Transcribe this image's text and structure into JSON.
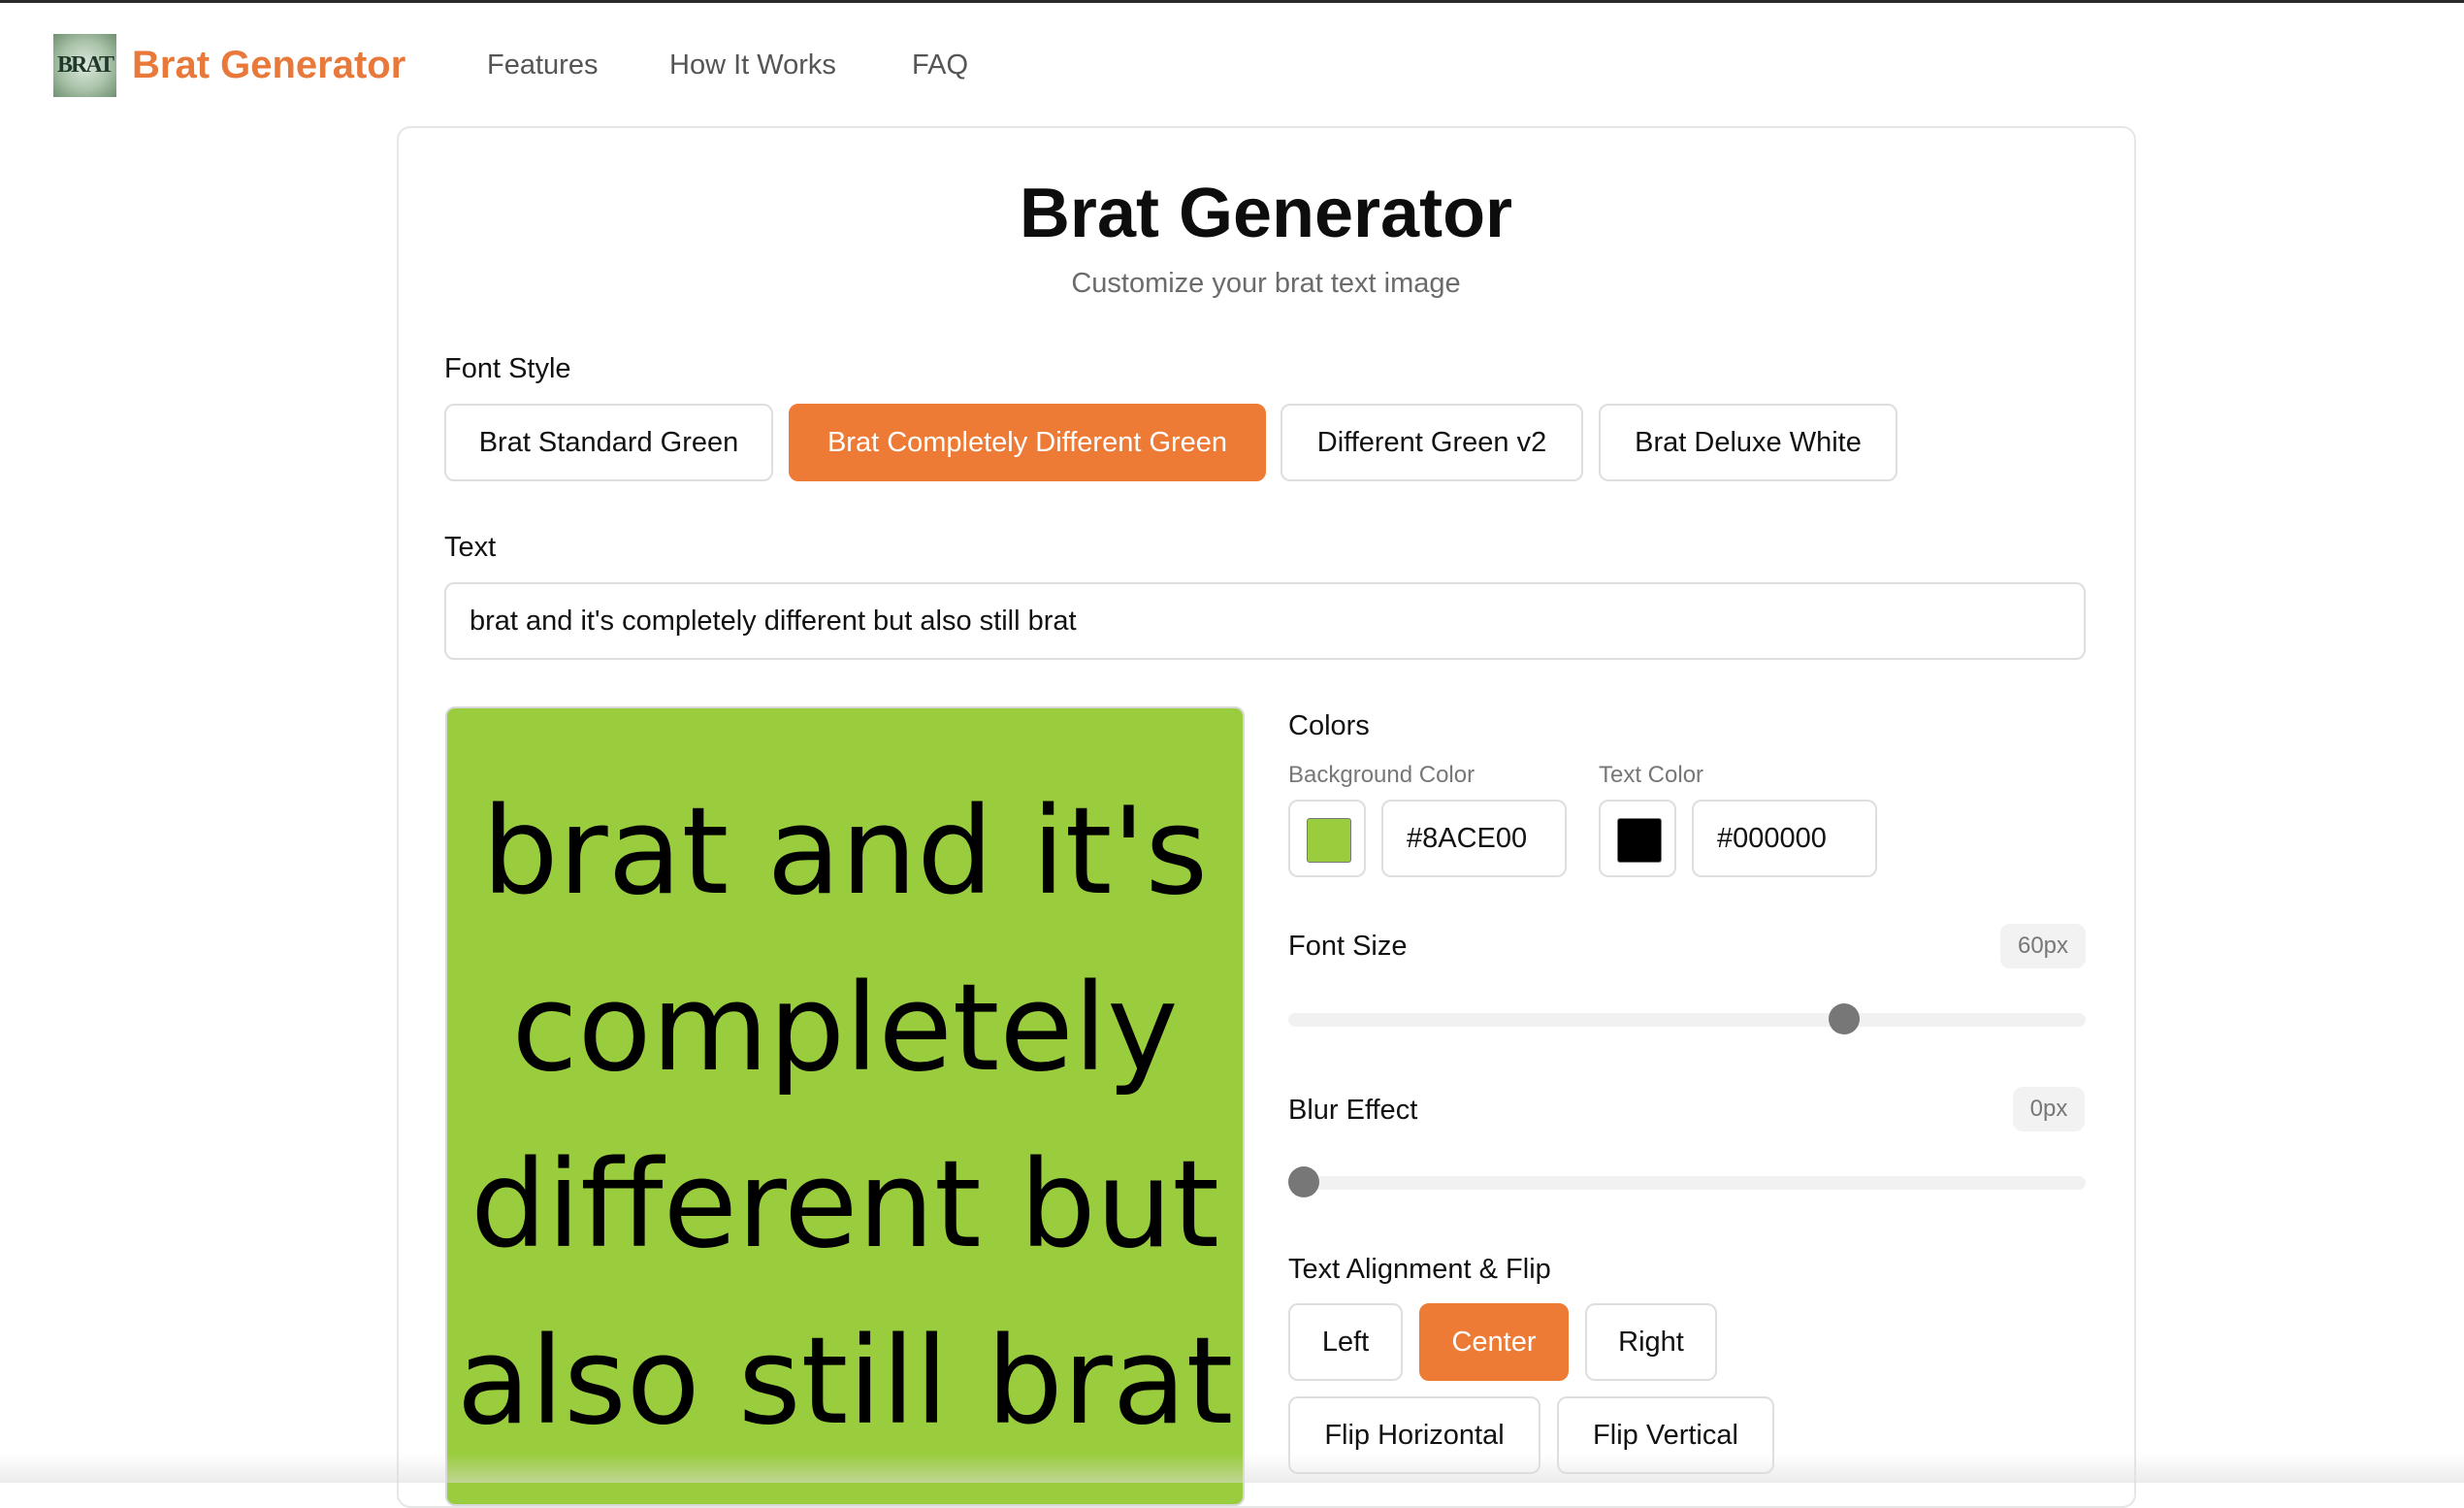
{
  "nav": {
    "logo_badge": "BRAT",
    "brand": "Brat Generator",
    "links": [
      "Features",
      "How It Works",
      "FAQ"
    ]
  },
  "card": {
    "title": "Brat Generator",
    "subtitle": "Customize your brat text image"
  },
  "font_style": {
    "label": "Font Style",
    "options": [
      "Brat Standard Green",
      "Brat Completely Different Green",
      "Different Green v2",
      "Brat Deluxe White"
    ],
    "selected": "Brat Completely Different Green"
  },
  "text_field": {
    "label": "Text",
    "value": "brat and it's completely different but also still brat"
  },
  "preview": {
    "lines": [
      "brat and it's",
      "completely",
      "different but",
      "also still brat"
    ]
  },
  "colors": {
    "label": "Colors",
    "background_label": "Background Color",
    "background_value": "#8ACE00",
    "text_label": "Text Color",
    "text_value": "#000000"
  },
  "font_size": {
    "label": "Font Size",
    "display": "60px",
    "level_fraction": 0.705
  },
  "blur": {
    "label": "Blur Effect",
    "display": "0px",
    "level_fraction": 0.0
  },
  "alignment": {
    "label": "Text Alignment & Flip",
    "options": [
      "Left",
      "Center",
      "Right"
    ],
    "selected": "Center",
    "flip_horizontal": "Flip Horizontal",
    "flip_vertical": "Flip Vertical"
  }
}
